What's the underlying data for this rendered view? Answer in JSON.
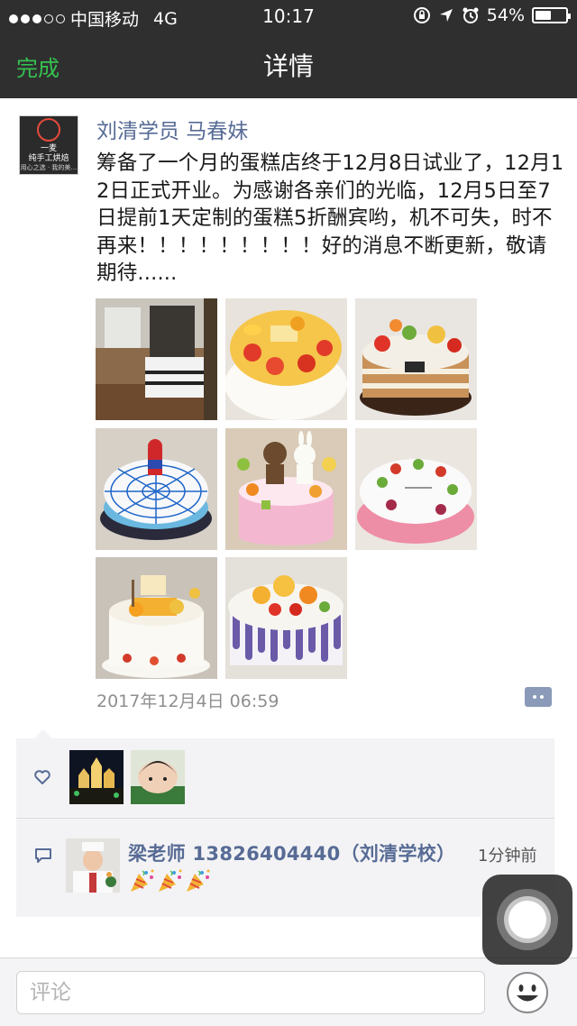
{
  "status_bar": {
    "carrier": "中国移动",
    "network": "4G",
    "time": "10:17",
    "battery": "54%",
    "battery_level": 0.54
  },
  "nav": {
    "done_label": "完成",
    "title": "详情"
  },
  "post": {
    "avatar": {
      "line1": "一麦",
      "line2": "纯手工烘焙",
      "line3": "用心之选 · 我的美…"
    },
    "author": "刘清学员 马春妹",
    "text": "筹备了一个月的蛋糕店终于12月8日试业了，12月12日正式开业。为感谢各亲们的光临，12月5日至7日提前1天定制的蛋糕5折酬宾哟，机不可失，时不再来！！！！！！！！！好的消息不断更新，敬请期待......",
    "photos": [
      {
        "icon": "shop-interior-photo"
      },
      {
        "icon": "fruit-cake-photo"
      },
      {
        "icon": "naked-fruit-cake-photo"
      },
      {
        "icon": "spiderman-cake-photo"
      },
      {
        "icon": "bear-bunny-cake-photo"
      },
      {
        "icon": "birthday-fruit-cake-photo"
      },
      {
        "icon": "mango-cake-photo"
      },
      {
        "icon": "purple-drip-cake-photo"
      }
    ],
    "timestamp": "2017年12月4日 06:59"
  },
  "likes": {
    "icon": "heart-icon",
    "users": [
      {
        "icon": "night-castle-avatar"
      },
      {
        "icon": "selfie-avatar"
      }
    ]
  },
  "comments": [
    {
      "author": "梁老师 13826404440（刘清学校）",
      "time": "1分钟前",
      "body_emoji": [
        "party-popper",
        "party-popper",
        "party-popper"
      ]
    }
  ],
  "bottom": {
    "placeholder": "评论",
    "emoji_icon": "smiley-icon"
  },
  "colors": {
    "nav_bg": "#2f2f30",
    "done_green": "#35c24f",
    "link_blue": "#576b95",
    "panel_bg": "#f3f3f5"
  }
}
